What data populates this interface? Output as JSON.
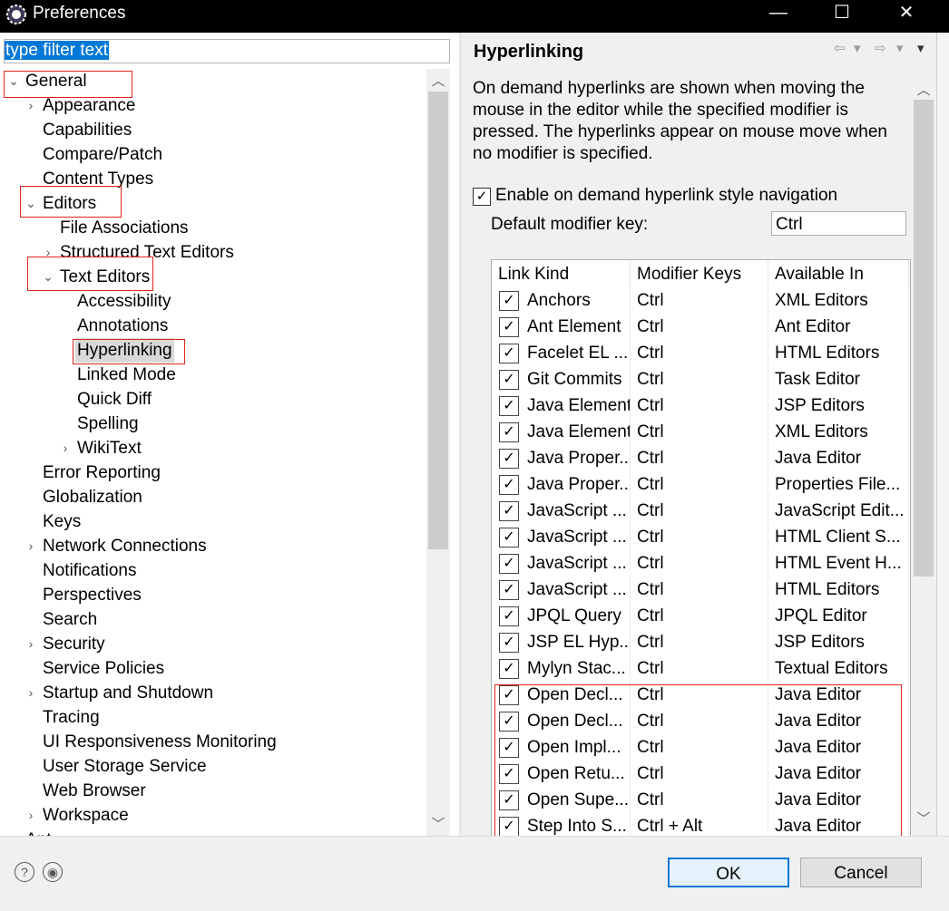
{
  "window": {
    "title": "Preferences",
    "minimize": "—",
    "maximize": "☐",
    "close": "✕"
  },
  "filter": {
    "value": "type filter text"
  },
  "tree": [
    {
      "label": "General",
      "depth": 0,
      "arrow": "⌄"
    },
    {
      "label": "Appearance",
      "depth": 1,
      "arrow": "›"
    },
    {
      "label": "Capabilities",
      "depth": 1,
      "arrow": ""
    },
    {
      "label": "Compare/Patch",
      "depth": 1,
      "arrow": ""
    },
    {
      "label": "Content Types",
      "depth": 1,
      "arrow": ""
    },
    {
      "label": "Editors",
      "depth": 1,
      "arrow": "⌄"
    },
    {
      "label": "File Associations",
      "depth": 2,
      "arrow": ""
    },
    {
      "label": "Structured Text Editors",
      "depth": 2,
      "arrow": "›"
    },
    {
      "label": "Text Editors",
      "depth": 2,
      "arrow": "⌄"
    },
    {
      "label": "Accessibility",
      "depth": 3,
      "arrow": ""
    },
    {
      "label": "Annotations",
      "depth": 3,
      "arrow": ""
    },
    {
      "label": "Hyperlinking",
      "depth": 3,
      "arrow": ""
    },
    {
      "label": "Linked Mode",
      "depth": 3,
      "arrow": ""
    },
    {
      "label": "Quick Diff",
      "depth": 3,
      "arrow": ""
    },
    {
      "label": "Spelling",
      "depth": 3,
      "arrow": ""
    },
    {
      "label": "WikiText",
      "depth": 3,
      "arrow": "›"
    },
    {
      "label": "Error Reporting",
      "depth": 1,
      "arrow": ""
    },
    {
      "label": "Globalization",
      "depth": 1,
      "arrow": ""
    },
    {
      "label": "Keys",
      "depth": 1,
      "arrow": ""
    },
    {
      "label": "Network Connections",
      "depth": 1,
      "arrow": "›"
    },
    {
      "label": "Notifications",
      "depth": 1,
      "arrow": ""
    },
    {
      "label": "Perspectives",
      "depth": 1,
      "arrow": ""
    },
    {
      "label": "Search",
      "depth": 1,
      "arrow": ""
    },
    {
      "label": "Security",
      "depth": 1,
      "arrow": "›"
    },
    {
      "label": "Service Policies",
      "depth": 1,
      "arrow": ""
    },
    {
      "label": "Startup and Shutdown",
      "depth": 1,
      "arrow": "›"
    },
    {
      "label": "Tracing",
      "depth": 1,
      "arrow": ""
    },
    {
      "label": "UI Responsiveness Monitoring",
      "depth": 1,
      "arrow": ""
    },
    {
      "label": "User Storage Service",
      "depth": 1,
      "arrow": ""
    },
    {
      "label": "Web Browser",
      "depth": 1,
      "arrow": ""
    },
    {
      "label": "Workspace",
      "depth": 1,
      "arrow": "›"
    },
    {
      "label": "Ant",
      "depth": 0,
      "arrow": "›"
    }
  ],
  "selected_tree_item": "Hyperlinking",
  "page": {
    "title": "Hyperlinking",
    "description": "On demand hyperlinks are shown when moving the mouse in the editor while the specified modifier is pressed. The hyperlinks appear on mouse move when no modifier is specified.",
    "enable_label": "Enable on demand hyperlink style navigation",
    "enable_checked": true,
    "modifier_label": "Default modifier key:",
    "modifier_value": "Ctrl"
  },
  "table": {
    "headers": [
      "Link Kind",
      "Modifier Keys",
      "Available In"
    ],
    "rows": [
      [
        "Anchors",
        "Ctrl",
        "XML Editors"
      ],
      [
        "Ant Element",
        "Ctrl",
        "Ant Editor"
      ],
      [
        "Facelet EL ...",
        "Ctrl",
        "HTML Editors"
      ],
      [
        "Git Commits",
        "Ctrl",
        "Task Editor"
      ],
      [
        "Java Element",
        "Ctrl",
        "JSP Editors"
      ],
      [
        "Java Element",
        "Ctrl",
        "XML Editors"
      ],
      [
        "Java Proper...",
        "Ctrl",
        "Java Editor"
      ],
      [
        "Java Proper...",
        "Ctrl",
        "Properties File..."
      ],
      [
        "JavaScript ...",
        "Ctrl",
        "JavaScript Edit..."
      ],
      [
        "JavaScript ...",
        "Ctrl",
        "HTML Client S..."
      ],
      [
        "JavaScript ...",
        "Ctrl",
        "HTML Event H..."
      ],
      [
        "JavaScript ...",
        "Ctrl",
        "HTML Editors"
      ],
      [
        "JPQL Query",
        "Ctrl",
        "JPQL Editor"
      ],
      [
        "JSP EL Hyp...",
        "Ctrl",
        "JSP Editors"
      ],
      [
        "Mylyn Stac...",
        "Ctrl",
        "Textual Editors"
      ],
      [
        "Open Decl...",
        "Ctrl",
        "Java Editor"
      ],
      [
        "Open Decl...",
        "Ctrl",
        "Java Editor"
      ],
      [
        "Open Impl...",
        "Ctrl",
        "Java Editor"
      ],
      [
        "Open Retu...",
        "Ctrl",
        "Java Editor"
      ],
      [
        "Open Supe...",
        "Ctrl",
        "Java Editor"
      ],
      [
        "Step Into S...",
        "Ctrl + Alt",
        "Java Editor"
      ]
    ]
  },
  "buttons": {
    "ok": "OK",
    "cancel": "Cancel",
    "help": "?",
    "record": "◉"
  },
  "icons": {
    "back": "⇦",
    "dropdown": "▾",
    "forward": "⇨",
    "menu": "▾",
    "check": "✓"
  },
  "colors": {
    "selection": "#0078d7",
    "annotation": "#e0261b"
  }
}
